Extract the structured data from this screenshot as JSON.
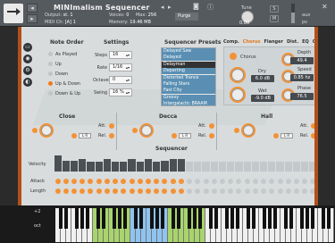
{
  "header": {
    "title": "MINImalism Sequencer",
    "output_label": "Output:",
    "output_value": "st. 1",
    "midi_label": "MIDI Ch:",
    "midi_value": "[A] 1",
    "voices_label": "Voices:",
    "voices_value": "0",
    "max_label": "Max:",
    "max_value": "256",
    "memory_label": "Memory:",
    "memory_value": "19.46 MB",
    "purge_label": "Purge",
    "tune_label": "Tune",
    "tune_value": "0.00",
    "solo_label": "S",
    "mute_label": "M",
    "aux_label": "aux",
    "pv_label": "pv"
  },
  "note_order": {
    "title": "Note Order",
    "options": [
      "As Played",
      "Up",
      "Down",
      "Up & Down",
      "Down & Up"
    ],
    "selected": "Up & Down"
  },
  "settings": {
    "title": "Settings",
    "rows": [
      {
        "label": "Steps",
        "value": "16"
      },
      {
        "label": "Rate",
        "value": "1/16"
      },
      {
        "label": "Octave",
        "value": "0"
      },
      {
        "label": "Swing",
        "value": "16 %"
      }
    ]
  },
  "presets": {
    "title": "Sequencer Presets",
    "items": [
      "Delayed Saw",
      "Delayed",
      "Delayman",
      "Departing",
      "Distorted Trance",
      "Falling Stars",
      "Fast City",
      "Groovy",
      "Intergalactic BRAAM"
    ],
    "selected": "Delayman"
  },
  "fx": {
    "tabs": [
      "Comp.",
      "Chorus",
      "Flanger",
      "Dist.",
      "EQ",
      "Conv."
    ],
    "active_tab": "Chorus",
    "chorus_label": "Chorus",
    "dry_label": "Dry",
    "dry_value": "6.0 dB",
    "wet_label": "Wet",
    "wet_value": "-9.0 dB",
    "depth_label": "Depth",
    "depth_value": "49.4",
    "speed_label": "Speed",
    "speed_value": "0.85 hz",
    "phase_label": "Phase",
    "phase_value": "76.5"
  },
  "reverbs": [
    {
      "title": "Close",
      "att": "Att.",
      "rel": "Rel.",
      "lr": "L R"
    },
    {
      "title": "Decca",
      "att": "Att.",
      "rel": "Rel.",
      "lr": "L R"
    },
    {
      "title": "Hall",
      "att": "Att.",
      "rel": "Rel.",
      "lr": "L R"
    }
  ],
  "sequencer": {
    "title": "Sequencer",
    "velocity_label": "Velocity",
    "attack_label": "Attack",
    "length_label": "Length",
    "steps_active": 16,
    "steps_total": 32,
    "velocity": [
      0.9,
      0.6,
      0.6,
      0.7,
      0.55,
      0.55,
      0.7,
      0.55,
      0.55,
      0.7,
      0.55,
      0.7,
      0.55,
      0.6,
      0.7,
      0.7,
      0.55,
      0.55,
      0.55,
      0.55,
      0.55,
      0.55,
      0.55,
      0.55,
      0.55,
      0.55,
      0.55,
      0.55,
      0.55,
      0.55,
      0.55,
      0.55
    ]
  },
  "keyboard": {
    "pitch_label": "+2",
    "oct_label": "oct"
  },
  "colors": {
    "accent": "#f39235",
    "border": "#b24f1a",
    "preset_bg": "#5a8fb3",
    "panel_bg": "#d9dcdd"
  }
}
